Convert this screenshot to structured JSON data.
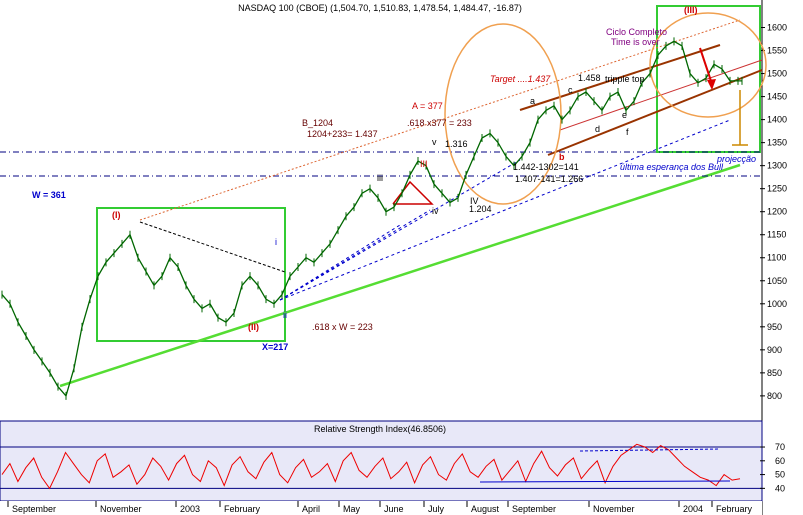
{
  "chart_data": {
    "type": "line",
    "title": "NASDAQ 100 (CBOE) (1,504.70, 1,510.83, 1,478.54, 1,484.47, -16.87)",
    "x_labels": [
      "September",
      "November",
      "2003",
      "February",
      "April",
      "May",
      "June",
      "July",
      "August",
      "September",
      "November",
      "2004",
      "February"
    ],
    "y_ticks": [
      800,
      850,
      900,
      950,
      1000,
      1050,
      1100,
      1150,
      1200,
      1250,
      1300,
      1350,
      1400,
      1450,
      1500,
      1550,
      1600
    ],
    "ylim": [
      765,
      1625
    ],
    "price_series": {
      "name": "NASDAQ 100",
      "x": [
        0,
        8,
        16,
        24,
        32,
        40,
        48,
        56,
        64,
        72,
        80,
        88,
        96,
        104,
        112,
        120,
        128,
        136,
        144,
        152,
        160,
        168,
        176,
        184,
        192,
        200,
        208,
        216,
        224,
        232,
        240,
        248,
        256,
        264,
        272,
        280,
        288,
        296,
        304,
        312,
        320,
        328,
        336,
        344,
        352,
        360,
        368,
        376,
        384,
        392,
        400,
        408,
        416,
        424,
        432,
        440,
        448,
        456,
        464,
        472,
        480,
        488,
        496,
        504,
        512,
        520,
        528,
        536,
        544,
        552,
        560,
        568,
        576,
        584,
        592,
        600,
        608,
        616,
        624,
        632,
        640,
        648,
        656,
        664,
        672,
        680,
        688,
        696,
        704,
        712,
        720,
        728,
        736,
        740
      ],
      "y": [
        1020,
        1000,
        960,
        930,
        900,
        875,
        850,
        820,
        800,
        860,
        950,
        1010,
        1060,
        1090,
        1110,
        1130,
        1150,
        1100,
        1070,
        1040,
        1060,
        1100,
        1080,
        1040,
        1010,
        990,
        1000,
        970,
        960,
        980,
        1040,
        1060,
        1040,
        1010,
        1000,
        1020,
        1060,
        1080,
        1100,
        1090,
        1110,
        1130,
        1160,
        1190,
        1210,
        1240,
        1250,
        1230,
        1200,
        1210,
        1240,
        1280,
        1310,
        1300,
        1260,
        1240,
        1220,
        1230,
        1280,
        1320,
        1360,
        1370,
        1350,
        1320,
        1300,
        1320,
        1350,
        1400,
        1420,
        1430,
        1400,
        1420,
        1450,
        1460,
        1440,
        1420,
        1450,
        1460,
        1420,
        1440,
        1480,
        1500,
        1540,
        1560,
        1570,
        1560,
        1500,
        1480,
        1490,
        1520,
        1510,
        1484,
        1484,
        1484
      ]
    },
    "rsi": {
      "label": "Relative Strength Index(46.8506)",
      "y_ticks": [
        40,
        50,
        60,
        70
      ],
      "ylim": [
        33,
        78
      ],
      "values": [
        50,
        58,
        45,
        55,
        62,
        48,
        40,
        52,
        66,
        58,
        50,
        44,
        60,
        65,
        48,
        52,
        57,
        43,
        50,
        62,
        56,
        46,
        58,
        64,
        50,
        45,
        60,
        55,
        42,
        57,
        63,
        52,
        47,
        59,
        66,
        50,
        44,
        55,
        61,
        48,
        52,
        58,
        45,
        60,
        66,
        53,
        48,
        56,
        62,
        47,
        52,
        59,
        44,
        57,
        63,
        50,
        46,
        58,
        65,
        52,
        48,
        56,
        61,
        46,
        53,
        60,
        45,
        58,
        67,
        55,
        49,
        57,
        62,
        47,
        54,
        60,
        44,
        56,
        64,
        68,
        72,
        70,
        66,
        71,
        68,
        62,
        56,
        52,
        48,
        46,
        42,
        50,
        46,
        47
      ]
    },
    "annotations": [
      {
        "text": "W = 361",
        "color": "#0000cc"
      },
      {
        "text": "(I)",
        "color": "#cc0000"
      },
      {
        "text": "(II)",
        "color": "#cc0000"
      },
      {
        "text": "(III)",
        "color": "#cc0000"
      },
      {
        "text": "X=217",
        "color": "#0000cc"
      },
      {
        "text": ".618 x W = 223",
        "color": "#660000"
      },
      {
        "text": "B_1204",
        "color": "#660000"
      },
      {
        "text": "1204+233= 1.437",
        "color": "#660000"
      },
      {
        "text": "A = 377",
        "color": "#cc0000"
      },
      {
        "text": ".618 x377 = 233",
        "color": "#660000"
      },
      {
        "text": "Target ....1.437",
        "color": "#cc0000"
      },
      {
        "text": "1.458",
        "color": "#000000"
      },
      {
        "text": "tripple top",
        "color": "#000000"
      },
      {
        "text": "Ciclo Completo",
        "color": "#800080"
      },
      {
        "text": "Time is over",
        "color": "#800080"
      },
      {
        "text": "1.442-1302=141",
        "color": "#000000"
      },
      {
        "text": "1.407-141=1.266",
        "color": "#000000"
      },
      {
        "text": "última esperança dos Bull",
        "color": "#0000cc"
      },
      {
        "text": "projecção",
        "color": "#0000cc"
      },
      {
        "text": "1.316",
        "color": "#000000"
      },
      {
        "text": "1.204",
        "color": "#000000"
      },
      {
        "text": "III",
        "color": "#cc0000"
      },
      {
        "text": "IV",
        "color": "#000000"
      },
      {
        "text": "iii",
        "color": "#000000"
      },
      {
        "text": "iv",
        "color": "#000000"
      },
      {
        "text": "v",
        "color": "#000000"
      },
      {
        "text": "a",
        "color": "#000000"
      },
      {
        "text": "b",
        "color": "#cc0000"
      },
      {
        "text": "c",
        "color": "#000000"
      },
      {
        "text": "d",
        "color": "#000000"
      },
      {
        "text": "e",
        "color": "#000000"
      },
      {
        "text": "f",
        "color": "#000000"
      },
      {
        "text": "i",
        "color": "#0000cc"
      },
      {
        "text": "ii",
        "color": "#0000cc"
      }
    ]
  }
}
